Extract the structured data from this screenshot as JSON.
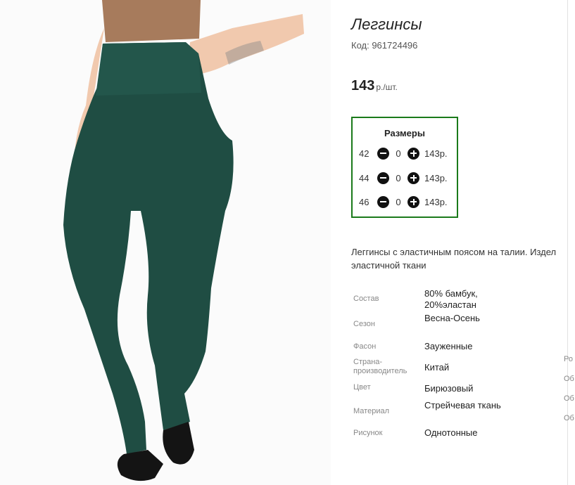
{
  "product": {
    "title": "Леггинсы",
    "code": "Код: 961724496",
    "price": "143",
    "price_unit": "р./шт."
  },
  "sizes": {
    "title": "Размеры",
    "rows": [
      {
        "size": "42",
        "qty": "0",
        "price": "143р."
      },
      {
        "size": "44",
        "qty": "0",
        "price": "143р."
      },
      {
        "size": "46",
        "qty": "0",
        "price": "143р."
      }
    ]
  },
  "description": {
    "line1": "Леггинсы с эластичным поясом на талии. Издел",
    "line2": "эластичной ткани"
  },
  "specs": [
    {
      "label": "Состав",
      "value": "80% бамбук, 20%эластан"
    },
    {
      "label": "Сезон",
      "value": "Весна-Осень"
    },
    {
      "label": "Фасон",
      "value": "Зауженные"
    },
    {
      "label": "Страна-производитель",
      "value": "Китай"
    },
    {
      "label": "Цвет",
      "value": "Бирюзовый"
    },
    {
      "label": "Материал",
      "value": "Стрейчевая ткань"
    },
    {
      "label": "Рисунок",
      "value": "Однотонные"
    }
  ],
  "edge_labels": [
    "Ро",
    "Об",
    "Об",
    "Об"
  ],
  "colors": {
    "accent_border": "#1a7a1a",
    "leggings": "#1f4d43",
    "top": "#a77b5c",
    "skin": "#f1c9ae"
  },
  "icons": [
    "minus-circle-icon",
    "plus-circle-icon"
  ]
}
